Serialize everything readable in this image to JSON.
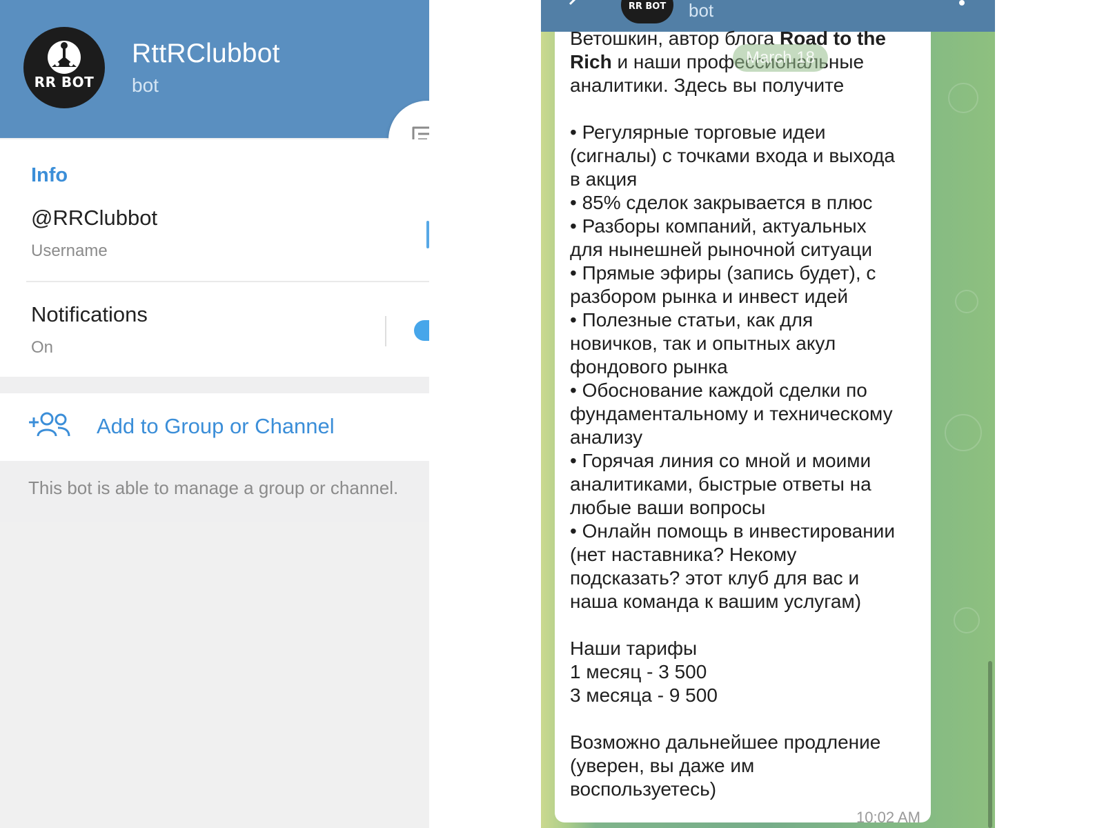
{
  "profile": {
    "avatar_text": "RR BOT",
    "name": "RttRClubbot",
    "subtitle": "bot"
  },
  "info": {
    "heading": "Info",
    "username": "@RRClubbot",
    "username_label": "Username",
    "notifications_label": "Notifications",
    "notifications_status": "On",
    "notifications_enabled": true
  },
  "actions": {
    "add_label": "Add to Group or Channel",
    "bot_note": "This bot is able to manage a group or channel."
  },
  "chat": {
    "header_avatar_text": "RR BOT",
    "header_subtitle": "bot",
    "date_pill": "March 18",
    "message_time": "10:02 AM",
    "lines": [
      [
        "Ветошкин, автор блога ",
        "Road to the"
      ],
      [
        "",
        "Rich",
        " и наши профессиональные"
      ],
      [
        "аналитики. Здесь вы получите"
      ],
      [
        ""
      ],
      [
        "• Регулярные торговые идеи"
      ],
      [
        "(сигналы) с точками входа и выхода"
      ],
      [
        "в акция"
      ],
      [
        "• 85% сделок закрывается в плюс"
      ],
      [
        "• Разборы компаний, актуальных"
      ],
      [
        "для нынешней рыночной ситуаци"
      ],
      [
        "• Прямые эфиры (запись будет), с"
      ],
      [
        "разбором рынка и инвест идей"
      ],
      [
        "• Полезные статьи, как для"
      ],
      [
        "новичков, так и опытных акул"
      ],
      [
        "фондового рынка"
      ],
      [
        "• Обоснование каждой сделки по"
      ],
      [
        "фундаментальному и техническому"
      ],
      [
        "анализу"
      ],
      [
        "• Горячая линия со мной и моими"
      ],
      [
        "аналитиками, быстрые ответы на"
      ],
      [
        "любые ваши вопросы"
      ],
      [
        "• Онлайн помощь в инвестировании"
      ],
      [
        "(нет наставника? Некому"
      ],
      [
        "подсказать? этот клуб для вас и"
      ],
      [
        "наша команда к вашим услугам)"
      ],
      [
        ""
      ],
      [
        "Наши тарифы"
      ],
      [
        "1 месяц - 3 500"
      ],
      [
        "3 месяца - 9 500"
      ],
      [
        ""
      ],
      [
        "Возможно дальнейшее продление"
      ],
      [
        "(уверен, вы даже им"
      ],
      [
        "воспользуетесь)"
      ]
    ]
  },
  "colors": {
    "header_blue": "#5a8fc0",
    "accent_blue": "#3b8ed8",
    "chat_header": "#527fa6"
  }
}
